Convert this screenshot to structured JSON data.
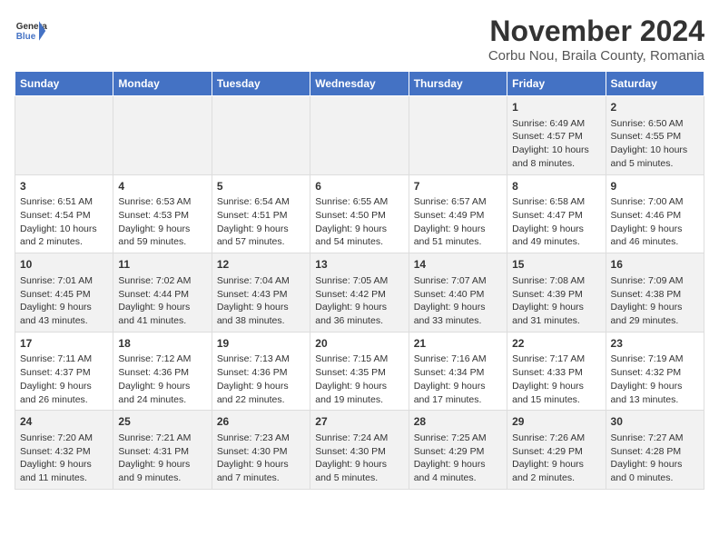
{
  "logo": {
    "line1": "General",
    "line2": "Blue"
  },
  "title": "November 2024",
  "subtitle": "Corbu Nou, Braila County, Romania",
  "days_of_week": [
    "Sunday",
    "Monday",
    "Tuesday",
    "Wednesday",
    "Thursday",
    "Friday",
    "Saturday"
  ],
  "weeks": [
    [
      {
        "day": "",
        "details": ""
      },
      {
        "day": "",
        "details": ""
      },
      {
        "day": "",
        "details": ""
      },
      {
        "day": "",
        "details": ""
      },
      {
        "day": "",
        "details": ""
      },
      {
        "day": "1",
        "details": "Sunrise: 6:49 AM\nSunset: 4:57 PM\nDaylight: 10 hours and 8 minutes."
      },
      {
        "day": "2",
        "details": "Sunrise: 6:50 AM\nSunset: 4:55 PM\nDaylight: 10 hours and 5 minutes."
      }
    ],
    [
      {
        "day": "3",
        "details": "Sunrise: 6:51 AM\nSunset: 4:54 PM\nDaylight: 10 hours and 2 minutes."
      },
      {
        "day": "4",
        "details": "Sunrise: 6:53 AM\nSunset: 4:53 PM\nDaylight: 9 hours and 59 minutes."
      },
      {
        "day": "5",
        "details": "Sunrise: 6:54 AM\nSunset: 4:51 PM\nDaylight: 9 hours and 57 minutes."
      },
      {
        "day": "6",
        "details": "Sunrise: 6:55 AM\nSunset: 4:50 PM\nDaylight: 9 hours and 54 minutes."
      },
      {
        "day": "7",
        "details": "Sunrise: 6:57 AM\nSunset: 4:49 PM\nDaylight: 9 hours and 51 minutes."
      },
      {
        "day": "8",
        "details": "Sunrise: 6:58 AM\nSunset: 4:47 PM\nDaylight: 9 hours and 49 minutes."
      },
      {
        "day": "9",
        "details": "Sunrise: 7:00 AM\nSunset: 4:46 PM\nDaylight: 9 hours and 46 minutes."
      }
    ],
    [
      {
        "day": "10",
        "details": "Sunrise: 7:01 AM\nSunset: 4:45 PM\nDaylight: 9 hours and 43 minutes."
      },
      {
        "day": "11",
        "details": "Sunrise: 7:02 AM\nSunset: 4:44 PM\nDaylight: 9 hours and 41 minutes."
      },
      {
        "day": "12",
        "details": "Sunrise: 7:04 AM\nSunset: 4:43 PM\nDaylight: 9 hours and 38 minutes."
      },
      {
        "day": "13",
        "details": "Sunrise: 7:05 AM\nSunset: 4:42 PM\nDaylight: 9 hours and 36 minutes."
      },
      {
        "day": "14",
        "details": "Sunrise: 7:07 AM\nSunset: 4:40 PM\nDaylight: 9 hours and 33 minutes."
      },
      {
        "day": "15",
        "details": "Sunrise: 7:08 AM\nSunset: 4:39 PM\nDaylight: 9 hours and 31 minutes."
      },
      {
        "day": "16",
        "details": "Sunrise: 7:09 AM\nSunset: 4:38 PM\nDaylight: 9 hours and 29 minutes."
      }
    ],
    [
      {
        "day": "17",
        "details": "Sunrise: 7:11 AM\nSunset: 4:37 PM\nDaylight: 9 hours and 26 minutes."
      },
      {
        "day": "18",
        "details": "Sunrise: 7:12 AM\nSunset: 4:36 PM\nDaylight: 9 hours and 24 minutes."
      },
      {
        "day": "19",
        "details": "Sunrise: 7:13 AM\nSunset: 4:36 PM\nDaylight: 9 hours and 22 minutes."
      },
      {
        "day": "20",
        "details": "Sunrise: 7:15 AM\nSunset: 4:35 PM\nDaylight: 9 hours and 19 minutes."
      },
      {
        "day": "21",
        "details": "Sunrise: 7:16 AM\nSunset: 4:34 PM\nDaylight: 9 hours and 17 minutes."
      },
      {
        "day": "22",
        "details": "Sunrise: 7:17 AM\nSunset: 4:33 PM\nDaylight: 9 hours and 15 minutes."
      },
      {
        "day": "23",
        "details": "Sunrise: 7:19 AM\nSunset: 4:32 PM\nDaylight: 9 hours and 13 minutes."
      }
    ],
    [
      {
        "day": "24",
        "details": "Sunrise: 7:20 AM\nSunset: 4:32 PM\nDaylight: 9 hours and 11 minutes."
      },
      {
        "day": "25",
        "details": "Sunrise: 7:21 AM\nSunset: 4:31 PM\nDaylight: 9 hours and 9 minutes."
      },
      {
        "day": "26",
        "details": "Sunrise: 7:23 AM\nSunset: 4:30 PM\nDaylight: 9 hours and 7 minutes."
      },
      {
        "day": "27",
        "details": "Sunrise: 7:24 AM\nSunset: 4:30 PM\nDaylight: 9 hours and 5 minutes."
      },
      {
        "day": "28",
        "details": "Sunrise: 7:25 AM\nSunset: 4:29 PM\nDaylight: 9 hours and 4 minutes."
      },
      {
        "day": "29",
        "details": "Sunrise: 7:26 AM\nSunset: 4:29 PM\nDaylight: 9 hours and 2 minutes."
      },
      {
        "day": "30",
        "details": "Sunrise: 7:27 AM\nSunset: 4:28 PM\nDaylight: 9 hours and 0 minutes."
      }
    ]
  ]
}
